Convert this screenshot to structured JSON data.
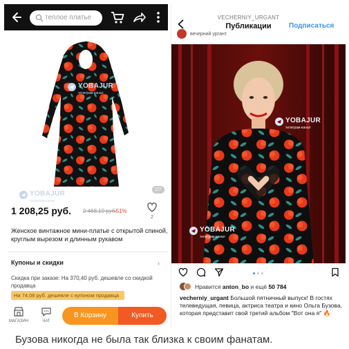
{
  "shop": {
    "search_placeholder": "теплое платье",
    "image_pager": "2/7",
    "watermark": {
      "brand": "YOBAJUR",
      "sub": "телеграм-канал"
    },
    "price": "1 208,25 руб.",
    "old_price": "2 468,19 руб.",
    "discount": "-51%",
    "likes_count": "2",
    "title": "Женское винтажное мини-платье с открытой спиной, круглым вырезом и длинным рукавом",
    "coupons_label": "Купоны и скидки",
    "discount_note": "Скидка при заказе: На 370,40 руб. дешевле со скидкой продавца",
    "coupon_badge": "На 74,08 руб. дешевле с купоном продавца",
    "nav": {
      "shop_label": "МАГАЗИН",
      "chat_label": "ЧАТ"
    },
    "add_to_cart_label": "В Корзину",
    "buy_label": "Купить"
  },
  "instagram": {
    "username": "VECHERNIY_URGANT",
    "header_title": "Публикации",
    "follow_label": "Подписаться",
    "mini_profile_name": "вечерний ургант",
    "liked_by_prefix": "Нравится",
    "liked_by_user": "anton_bo",
    "liked_by_suffix": "и ещё",
    "likes_count": "50 784",
    "caption_user": "vecherniy_urgant",
    "caption_text": "Большой пятничный выпуск! В гостях телеведущая, певица, актриса театра и кино Ольга Бузова, которая представит свой третий альбом \"Вот она я\" 🔥",
    "watermark": {
      "brand": "YOBAJUR",
      "sub": "телеграм-канал"
    }
  },
  "footer_text": "Бузова никогда не была так близка к своим фанатам.",
  "colors": {
    "dress_black": "#111111",
    "poppy_red": "#e8391b",
    "leaf_teal": "#2f8f88",
    "cart_orange": "#f79520",
    "buy_orange": "#f15a22",
    "ig_blue": "#3897f0",
    "studio_red": "#b3151d"
  }
}
